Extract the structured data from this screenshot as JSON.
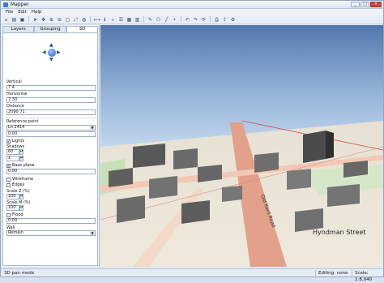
{
  "window": {
    "title": "Mapper"
  },
  "menu": [
    "File",
    "Edit",
    "Help"
  ],
  "tabs": [
    "Layers",
    "Grouping",
    "3D"
  ],
  "panel": {
    "vertical_label": "Vertical",
    "vertical_value": "7.4",
    "horizontal_label": "Horizontal",
    "horizontal_value": "7.30",
    "distance_label": "Distance",
    "distance_value": "2090.71",
    "reference_label": "Reference point",
    "reference_value": "Ln 2414",
    "reference_sub": "0.00",
    "lights_label": "Lights",
    "shadows_label": "Shadows",
    "shadows_value": "60",
    "shadows_sub": "1",
    "baseplane_label": "Base plane",
    "baseplane_value": "0.00",
    "wireframe_label": "Wireframe",
    "edges_label": "Edges",
    "scalez_label": "Scale Z (%)",
    "scalez_value": "100",
    "scalexy_label": "Scale M (%)",
    "scalexy_value": "100",
    "flood_label": "Flood",
    "flood_value": "0.00",
    "wall_label": "Wall",
    "wall_value": "Remain"
  },
  "status": {
    "mode": "3D pan mode",
    "editing": "Editing: none",
    "scale": "Scale: 1:8,040"
  },
  "map_labels": {
    "road_a": "Old Kent Road",
    "road_b": "Hyndman Street"
  },
  "colors": {
    "sky_top": "#4e73a8",
    "sky_bottom": "#bcd2ea",
    "accent": "#3a7ad0"
  }
}
